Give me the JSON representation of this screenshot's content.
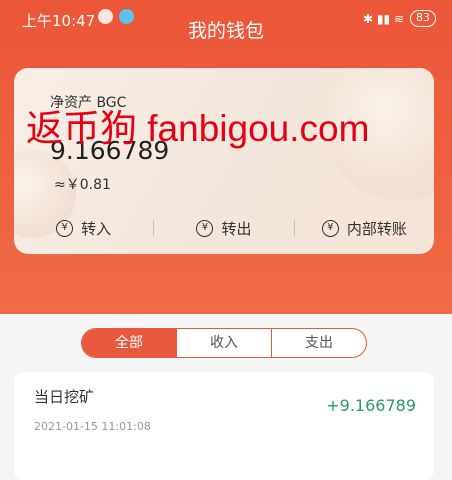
{
  "status_bar": {
    "time": "上午10:47",
    "right_indicators": "✱ ▮▮ ≋",
    "battery": "83"
  },
  "page": {
    "title": "我的钱包"
  },
  "wallet_card": {
    "label": "净资产 BGC",
    "value": "9.166789",
    "fiat_value": "≈￥0.81",
    "actions": [
      {
        "label": "转入",
        "icon": "yen-icon"
      },
      {
        "label": "转出",
        "icon": "yen-icon"
      },
      {
        "label": "内部转账",
        "icon": "yen-icon"
      }
    ]
  },
  "watermark": "返币狗 fanbigou.com",
  "filter_tabs": [
    {
      "label": "全部",
      "active": true
    },
    {
      "label": "收入",
      "active": false
    },
    {
      "label": "支出",
      "active": false
    }
  ],
  "records": [
    {
      "title": "当日挖矿",
      "time": "2021-01-15 11:01:08",
      "amount": "+9.166789"
    }
  ],
  "colors": {
    "header": "#ec5638",
    "accent": "#e8583c",
    "income": "#2e9a6a"
  }
}
